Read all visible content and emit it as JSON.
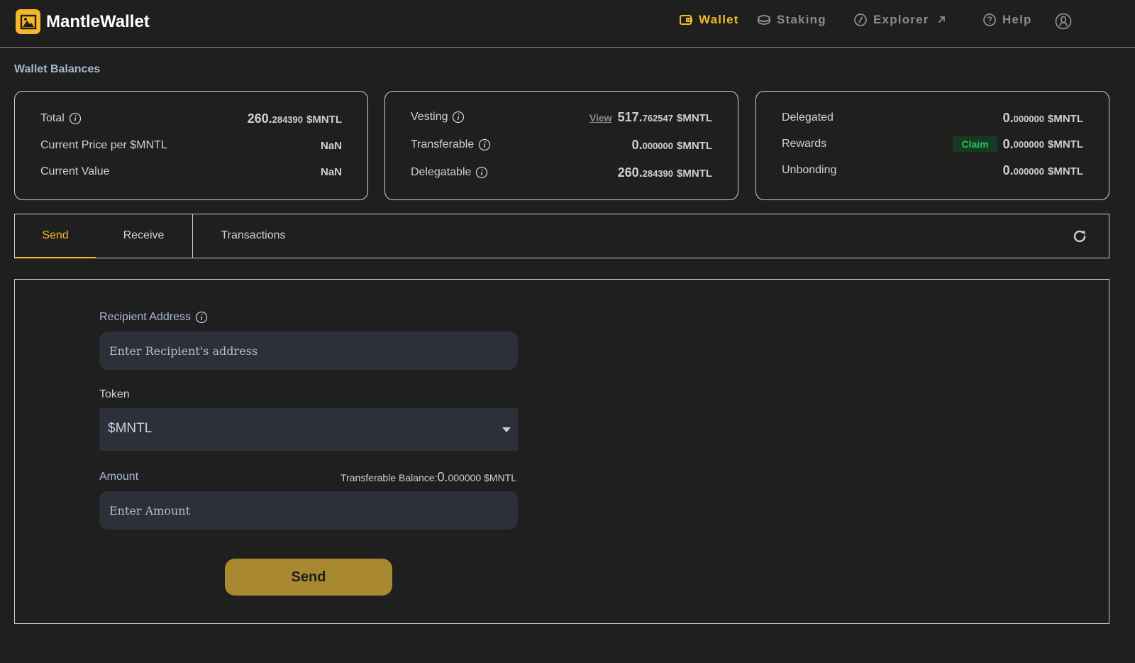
{
  "app": {
    "name": "MantleWallet"
  },
  "nav": {
    "wallet": "Wallet",
    "staking": "Staking",
    "explorer": "Explorer",
    "help": "Help"
  },
  "section_title": "Wallet Balances",
  "cards": {
    "card1": {
      "total_label": "Total",
      "total_int": "260.",
      "total_dec": "284390",
      "total_unit": "$MNTL",
      "price_label": "Current Price per $MNTL",
      "price_value": "NaN",
      "value_label": "Current Value",
      "value_value": "NaN"
    },
    "card2": {
      "vesting_label": "Vesting",
      "view_link": "View",
      "vesting_int": "517.",
      "vesting_dec": "762547",
      "vesting_unit": "$MNTL",
      "transferable_label": "Transferable",
      "transferable_int": "0.",
      "transferable_dec": "000000",
      "transferable_unit": "$MNTL",
      "delegatable_label": "Delegatable",
      "delegatable_int": "260.",
      "delegatable_dec": "284390",
      "delegatable_unit": "$MNTL"
    },
    "card3": {
      "delegated_label": "Delegated",
      "delegated_int": "0.",
      "delegated_dec": "000000",
      "delegated_unit": "$MNTL",
      "rewards_label": "Rewards",
      "claim_label": "Claim",
      "rewards_int": "0.",
      "rewards_dec": "000000",
      "rewards_unit": "$MNTL",
      "unbonding_label": "Unbonding",
      "unbonding_int": "0.",
      "unbonding_dec": "000000",
      "unbonding_unit": "$MNTL"
    }
  },
  "tabs": {
    "send": "Send",
    "receive": "Receive",
    "transactions": "Transactions"
  },
  "form": {
    "recipient_label": "Recipient Address",
    "recipient_placeholder": "Enter Recipient's address",
    "token_label": "Token",
    "token_selected": "$MNTL",
    "amount_label": "Amount",
    "balance_hint_prefix": "Transferable Balance:",
    "balance_hint_int": "0.",
    "balance_hint_dec": "000000",
    "balance_hint_unit": "$MNTL",
    "amount_placeholder": "Enter Amount",
    "send_button": "Send"
  },
  "colors": {
    "accent": "#f5b82a",
    "background": "#1f1f1f",
    "send_button": "#a88830",
    "input_bg": "#2c3039",
    "claim_green": "#2fc15f"
  },
  "icons": {
    "logo": "mantle-logo-icon",
    "wallet": "wallet-icon",
    "staking": "coins-icon",
    "explorer": "compass-icon",
    "external": "external-link-icon",
    "help": "question-circle-icon",
    "account": "account-icon",
    "info": "info-icon",
    "refresh": "refresh-icon",
    "caret": "caret-down-icon"
  }
}
